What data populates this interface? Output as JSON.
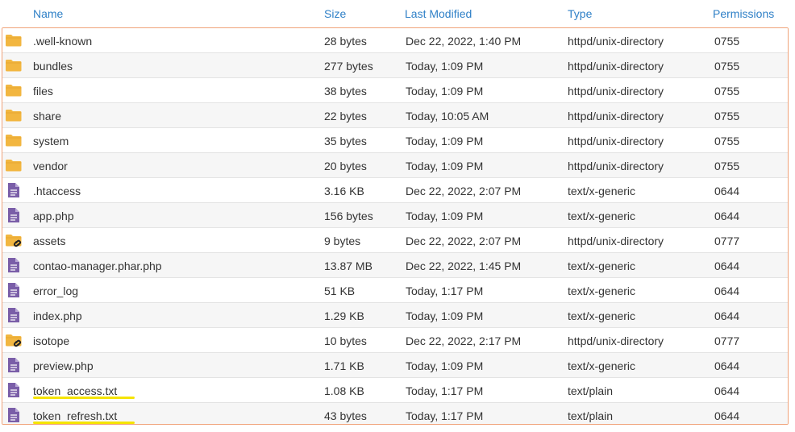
{
  "columns": {
    "name": "Name",
    "size": "Size",
    "modified": "Last Modified",
    "type": "Type",
    "permissions": "Permissions"
  },
  "colors": {
    "header_link": "#2f80c7",
    "folder": "#f2b640",
    "file": "#7a5ea8",
    "row_border": "#f0a37a",
    "highlight": "#f5e400"
  },
  "rows": [
    {
      "icon": "folder-icon",
      "name": ".well-known",
      "size": "28 bytes",
      "modified": "Dec 22, 2022, 1:40 PM",
      "type": "httpd/unix-directory",
      "perms": "0755"
    },
    {
      "icon": "folder-icon",
      "name": "bundles",
      "size": "277 bytes",
      "modified": "Today, 1:09 PM",
      "type": "httpd/unix-directory",
      "perms": "0755"
    },
    {
      "icon": "folder-icon",
      "name": "files",
      "size": "38 bytes",
      "modified": "Today, 1:09 PM",
      "type": "httpd/unix-directory",
      "perms": "0755"
    },
    {
      "icon": "folder-icon",
      "name": "share",
      "size": "22 bytes",
      "modified": "Today, 10:05 AM",
      "type": "httpd/unix-directory",
      "perms": "0755"
    },
    {
      "icon": "folder-icon",
      "name": "system",
      "size": "35 bytes",
      "modified": "Today, 1:09 PM",
      "type": "httpd/unix-directory",
      "perms": "0755"
    },
    {
      "icon": "folder-icon",
      "name": "vendor",
      "size": "20 bytes",
      "modified": "Today, 1:09 PM",
      "type": "httpd/unix-directory",
      "perms": "0755"
    },
    {
      "icon": "file-icon",
      "name": ".htaccess",
      "size": "3.16 KB",
      "modified": "Dec 22, 2022, 2:07 PM",
      "type": "text/x-generic",
      "perms": "0644"
    },
    {
      "icon": "file-icon",
      "name": "app.php",
      "size": "156 bytes",
      "modified": "Today, 1:09 PM",
      "type": "text/x-generic",
      "perms": "0644"
    },
    {
      "icon": "folder-link-icon",
      "name": "assets",
      "size": "9 bytes",
      "modified": "Dec 22, 2022, 2:07 PM",
      "type": "httpd/unix-directory",
      "perms": "0777"
    },
    {
      "icon": "file-icon",
      "name": "contao-manager.phar.php",
      "size": "13.87 MB",
      "modified": "Dec 22, 2022, 1:45 PM",
      "type": "text/x-generic",
      "perms": "0644"
    },
    {
      "icon": "file-icon",
      "name": "error_log",
      "size": "51 KB",
      "modified": "Today, 1:17 PM",
      "type": "text/x-generic",
      "perms": "0644"
    },
    {
      "icon": "file-icon",
      "name": "index.php",
      "size": "1.29 KB",
      "modified": "Today, 1:09 PM",
      "type": "text/x-generic",
      "perms": "0644"
    },
    {
      "icon": "folder-link-icon",
      "name": "isotope",
      "size": "10 bytes",
      "modified": "Dec 22, 2022, 2:17 PM",
      "type": "httpd/unix-directory",
      "perms": "0777"
    },
    {
      "icon": "file-icon",
      "name": "preview.php",
      "size": "1.71 KB",
      "modified": "Today, 1:09 PM",
      "type": "text/x-generic",
      "perms": "0644"
    },
    {
      "icon": "file-icon",
      "name": "token_access.txt",
      "size": "1.08 KB",
      "modified": "Today, 1:17 PM",
      "type": "text/plain",
      "perms": "0644",
      "highlighted": true
    },
    {
      "icon": "file-icon",
      "name": "token_refresh.txt",
      "size": "43 bytes",
      "modified": "Today, 1:17 PM",
      "type": "text/plain",
      "perms": "0644",
      "highlighted": true
    }
  ]
}
